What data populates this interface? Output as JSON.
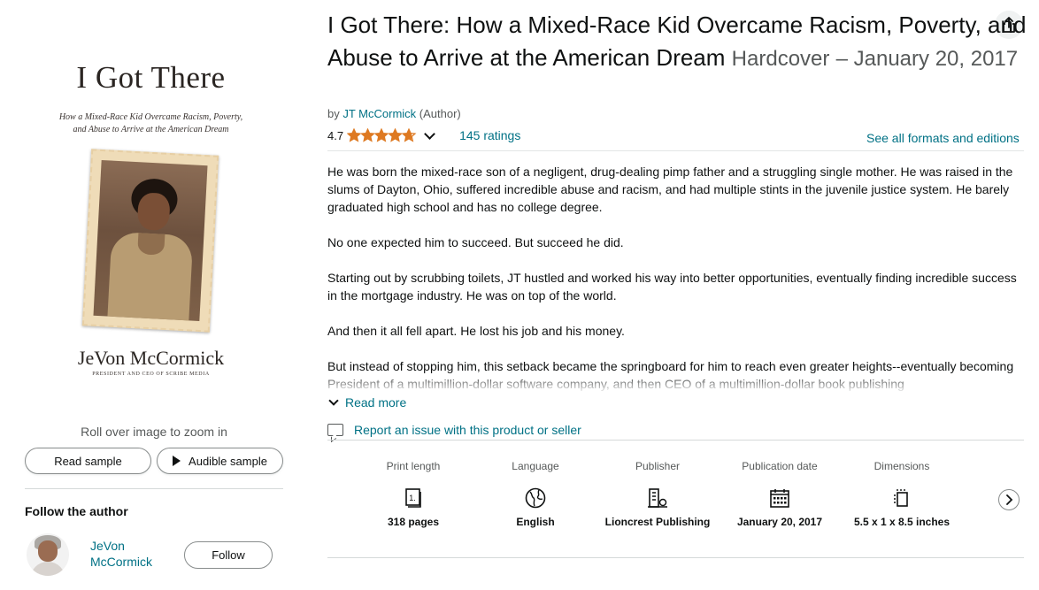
{
  "cover": {
    "title": "I Got There",
    "subtitle": "How a Mixed-Race Kid Overcame Racism, Poverty, and Abuse to Arrive at the American Dream",
    "author": "JeVon McCormick",
    "author_role": "PRESIDENT AND CEO OF SCRIBE MEDIA"
  },
  "image_panel": {
    "zoom_hint": "Roll over image to zoom in",
    "read_sample_label": "Read sample",
    "audible_sample_label": "Audible sample"
  },
  "follow": {
    "heading": "Follow the author",
    "author_name": "JeVon McCormick",
    "follow_label": "Follow"
  },
  "product": {
    "title": "I Got There: How a Mixed-Race Kid Overcame Racism, Poverty, and Abuse to Arrive at the American Dream",
    "format": "Hardcover",
    "date": "– January 20, 2017",
    "by_prefix": "by",
    "author": "JT McCormick",
    "author_role": "(Author)",
    "rating": "4.7",
    "stars": 4.7,
    "ratings_count": "145 ratings",
    "formats_link": "See all formats and editions"
  },
  "description": {
    "paragraphs": [
      "He was born the mixed-race son of a negligent, drug-dealing pimp father and a struggling single mother. He was raised in the slums of Dayton, Ohio, suffered incredible abuse and racism, and had multiple stints in the juvenile justice system. He barely graduated high school and has no college degree.",
      "No one expected him to succeed. But succeed he did.",
      "Starting out by scrubbing toilets, JT hustled and worked his way into better opportunities, eventually finding incredible success in the mortgage industry. He was on top of the world.",
      "And then it all fell apart. He lost his job and his money.",
      "But instead of stopping him, this setback became the springboard for him to reach even greater heights--eventually becoming President of a multimillion-dollar software company, and then CEO of a multimillion-dollar book publishing"
    ],
    "read_more": "Read more"
  },
  "report": {
    "label": "Report an issue with this product or seller"
  },
  "details": [
    {
      "label": "Print length",
      "icon": "book-pages-icon",
      "value": "318 pages"
    },
    {
      "label": "Language",
      "icon": "globe-icon",
      "value": "English"
    },
    {
      "label": "Publisher",
      "icon": "building-icon",
      "value": "Lioncrest Publishing"
    },
    {
      "label": "Publication date",
      "icon": "calendar-icon",
      "value": "January 20, 2017"
    },
    {
      "label": "Dimensions",
      "icon": "dimensions-icon",
      "value": "5.5 x 1 x 8.5 inches"
    }
  ],
  "colors": {
    "link": "#007185",
    "star": "#de7921",
    "text": "#0f1111",
    "muted": "#565959"
  }
}
